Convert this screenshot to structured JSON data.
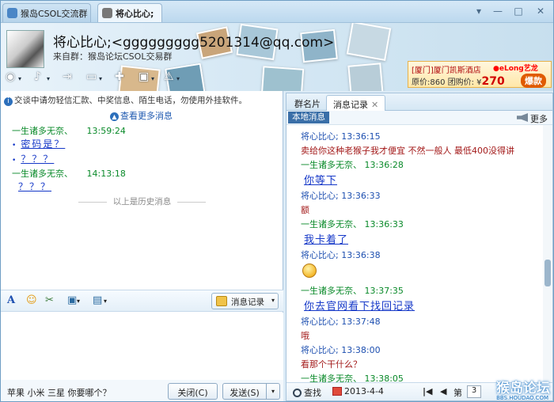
{
  "tabs": [
    {
      "label": "猴岛CSOL交流群",
      "active": false
    },
    {
      "label": "将心比心;",
      "active": true
    }
  ],
  "window_controls": {
    "pin": "▾",
    "minimize": "—",
    "maximize": "□",
    "close": "✕"
  },
  "header": {
    "nickname": "将心比心;<ggggggggg5201314@qq.com>",
    "source": "来自群：猴岛论坛CSOL交易群"
  },
  "ad": {
    "line1": "[厦门]厦门凯斯酒店",
    "line2_prefix": "原价:860 团购价: ¥",
    "price": "270",
    "badge": "爆款",
    "brand": "●eLong艺龙"
  },
  "left": {
    "notice": "交谈中请勿轻信汇款、中奖信息、陌生电话，勿使用外挂软件。",
    "view_more": "查看更多消息",
    "messages": [
      {
        "name": "一生诸多无奈、",
        "time": "13:59:24"
      },
      {
        "text": "密码是？"
      },
      {
        "text": "？？？"
      },
      {
        "name": "一生诸多无奈、",
        "time": "14:13:18"
      },
      {
        "text": "？？？"
      }
    ],
    "history_divider": "以上是历史消息",
    "toolbar": {
      "font": "A",
      "emoji": "☺",
      "screenshot": "✂",
      "image": "▣",
      "more": "▤",
      "history_button": "消息记录"
    },
    "input_text": "苹果 小米 三星 你要哪个？",
    "close_button": "关闭(C)",
    "send_button": "发送(S)"
  },
  "right": {
    "tabs": {
      "members": "群名片",
      "history": "消息记录",
      "close": "✕"
    },
    "local_tag": "本地消息",
    "more": "更多",
    "messages": [
      {
        "kind": "me",
        "name": "将心比心;",
        "time": "13:36:15"
      },
      {
        "kind": "red",
        "text": "卖给你这种老猴子我才便宜 不然一般人 最低400没得讲"
      },
      {
        "kind": "other",
        "name": "一生诸多无奈、",
        "time": "13:36:28"
      },
      {
        "kind": "blue",
        "text": "你等下"
      },
      {
        "kind": "me",
        "name": "将心比心;",
        "time": "13:36:33"
      },
      {
        "kind": "red",
        "text": "额"
      },
      {
        "kind": "other",
        "name": "一生诸多无奈、",
        "time": "13:36:33"
      },
      {
        "kind": "blue",
        "text": "我卡着了"
      },
      {
        "kind": "me",
        "name": "将心比心;",
        "time": "13:36:38"
      },
      {
        "kind": "other",
        "name": "一生诸多无奈、",
        "time": "13:37:35"
      },
      {
        "kind": "blue",
        "text": "你去官网看下找回记录"
      },
      {
        "kind": "me",
        "name": "将心比心;",
        "time": "13:37:48"
      },
      {
        "kind": "red",
        "text": "哦"
      },
      {
        "kind": "me",
        "name": "将心比心;",
        "time": "13:38:00"
      },
      {
        "kind": "red",
        "text": "看那个干什么？"
      },
      {
        "kind": "other",
        "name": "一生诸多无奈、",
        "time": "13:38:05"
      }
    ],
    "bottom": {
      "search": "查找",
      "date": "2013-4-4",
      "page_prefix": "第",
      "page": "3"
    }
  },
  "watermark": {
    "main": "猴岛论坛",
    "url": "BBS.HOUDAO.COM"
  }
}
